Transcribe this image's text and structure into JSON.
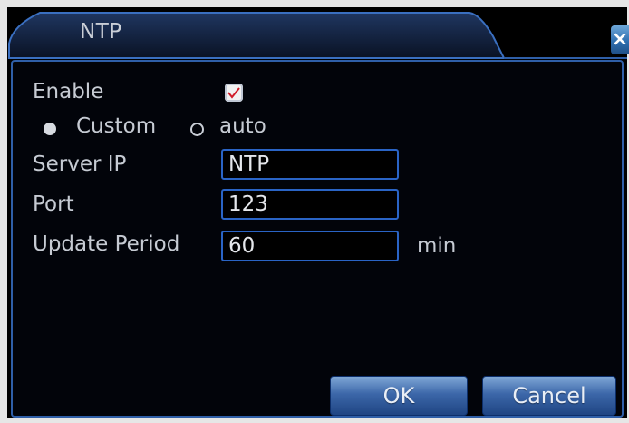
{
  "window": {
    "title": "NTP",
    "close_glyph": "×"
  },
  "form": {
    "enable_label": "Enable",
    "enable_checked": true,
    "mode_options": [
      {
        "label": "Custom",
        "selected": true
      },
      {
        "label": "auto",
        "selected": false
      }
    ],
    "server_ip_label": "Server IP",
    "server_ip_value": "NTP",
    "port_label": "Port",
    "port_value": "123",
    "update_period_label": "Update Period",
    "update_period_value": "60",
    "update_period_unit": "min"
  },
  "buttons": {
    "ok_label": "OK",
    "cancel_label": "Cancel"
  },
  "colors": {
    "accent": "#2a64c5",
    "background": "#000000",
    "text": "#c6cbd3"
  }
}
